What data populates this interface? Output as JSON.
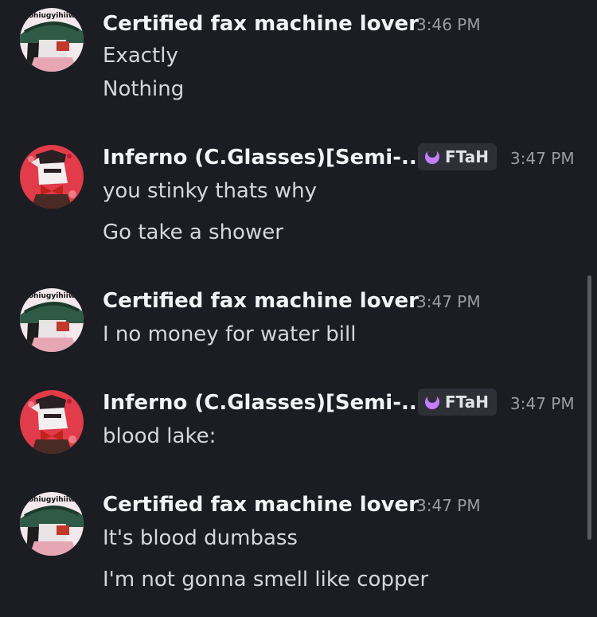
{
  "messages": [
    {
      "author": "Certified fax machine lover",
      "time": "3:46 PM",
      "avatar_icon": "green-hat-character-avatar-icon",
      "avatar_text": "ohiugyihiiw",
      "lines": [
        "Exactly",
        "Nothing"
      ]
    },
    {
      "author": "Inferno (C.Glasses)[Semi-...",
      "time": "3:47 PM",
      "tag": "FTaH",
      "tag_icon": "purple-moon-icon",
      "avatar_icon": "red-bow-character-avatar-icon",
      "lines": [
        "you stinky thats why",
        "Go take a shower"
      ]
    },
    {
      "author": "Certified fax machine lover",
      "time": "3:47 PM",
      "avatar_icon": "green-hat-character-avatar-icon",
      "avatar_text": "ohiugyihiiw",
      "lines": [
        "I no money for water bill"
      ]
    },
    {
      "author": "Inferno (C.Glasses)[Semi-...",
      "time": "3:47 PM",
      "tag": "FTaH",
      "tag_icon": "purple-moon-icon",
      "avatar_icon": "red-bow-character-avatar-icon",
      "lines": [
        "blood lake:"
      ]
    },
    {
      "author": "Certified fax machine lover",
      "time": "3:47 PM",
      "avatar_icon": "green-hat-character-avatar-icon",
      "avatar_text": "ohiugyihiiw",
      "lines": [
        "It's blood dumbass",
        "I'm not gonna smell like copper"
      ]
    }
  ],
  "colors": {
    "background": "#1c1d22",
    "username": "#f2f3f5",
    "message_text": "#d6d7dc",
    "timestamp": "#9a9ca3",
    "tag_background": "#2e3038",
    "tag_icon": "#c77dff"
  }
}
